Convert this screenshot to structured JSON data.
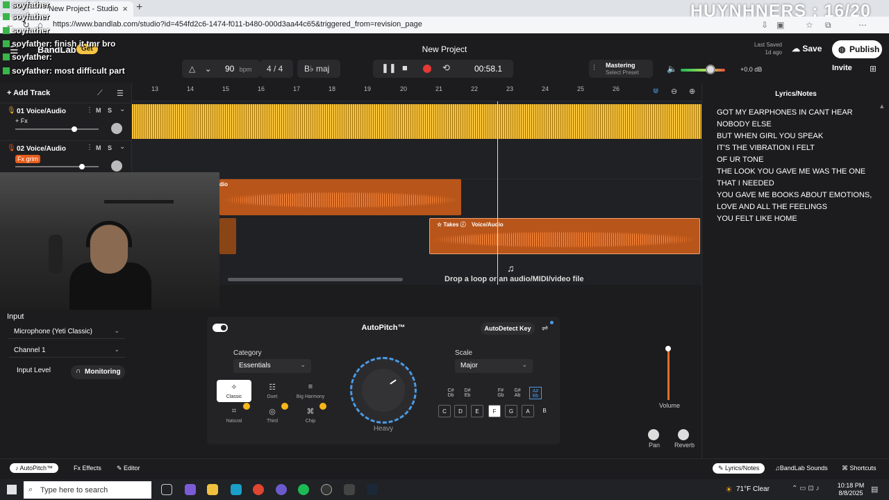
{
  "browser": {
    "tab_title": "New Project - Studio",
    "url": "https://www.bandlab.com/studio?id=454fd2c6-1474-f011-b480-000d3aa44c65&triggered_from=revision_page",
    "overlay_title": "HUYNHNERS : 16/20"
  },
  "chat": [
    {
      "user": "soyfather",
      "message": ""
    },
    {
      "user": "soyfather",
      "message": ""
    },
    {
      "user": "soyfather",
      "message": ""
    },
    {
      "user": "soyfather",
      "message": ": finish it tmr bro"
    },
    {
      "user": "soyfather",
      "message": ":"
    },
    {
      "user": "soyfather",
      "message": ": most difficult part"
    }
  ],
  "header": {
    "brand": "BandLab",
    "get_label": "Get",
    "project_title": "New Project",
    "last_saved_label": "Last Saved",
    "last_saved_value": "1d ago",
    "save_label": "Save",
    "publish_label": "Publish",
    "invite_label": "Invite"
  },
  "transport": {
    "tempo": "90",
    "tempo_unit": "bpm",
    "time_signature": "4 / 4",
    "key": "B♭ maj",
    "timecode": "00:58.1"
  },
  "mastering": {
    "label": "Mastering",
    "sub": "Select Preset"
  },
  "master_volume": {
    "db": "+0.0 dB",
    "level": 0.6
  },
  "tracks": [
    {
      "number": "01",
      "name": "Voice/Audio",
      "fx": "+ Fx",
      "mute": "M",
      "solo": "S",
      "volume": 0.72
    },
    {
      "number": "02",
      "name": "Voice/Audio",
      "fx": "Fx grim",
      "mute": "M",
      "solo": "S",
      "volume": 0.8
    }
  ],
  "add_track_label": "Add Track",
  "ruler": [
    "13",
    "14",
    "15",
    "16",
    "17",
    "18",
    "19",
    "20",
    "21",
    "22",
    "23",
    "24",
    "25",
    "26"
  ],
  "clips": {
    "clip_a_label": "dio",
    "takes_label": "Takes",
    "takes_track": "Voice/Audio"
  },
  "drop_text": "Drop a loop or an audio/MIDI/video file",
  "lyrics": {
    "title": "Lyrics/Notes",
    "lines": [
      "GOT MY EARPHONES IN CANT HEAR",
      "NOBODY ELSE",
      "BUT WHEN GIRL YOU SPEAK",
      "IT'S THE VIBRATION I FELT",
      "OF UR TONE",
      "THE LOOK YOU GAVE ME WAS THE ONE",
      "THAT I NEEDED",
      "YOU GAVE ME BOOKS ABOUT EMOTIONS,",
      "LOVE AND ALL THE FEELINGS",
      "YOU FELT LIKE HOME"
    ]
  },
  "input": {
    "title": "Input",
    "device": "Microphone (Yeti Classic)",
    "channel": "Channel 1",
    "level_label": "Input Level",
    "monitoring_label": "Monitoring"
  },
  "autopitch": {
    "title": "AutoPitch™",
    "autodetect_label": "AutoDetect Key",
    "category_label": "Category",
    "category_value": "Essentials",
    "scale_label": "Scale",
    "scale_value": "Major",
    "presets": [
      "Classic",
      "Duet",
      "Big Harmony",
      "Natural",
      "Third",
      "Chip"
    ],
    "dial_label": "Heavy",
    "accidentals": [
      "C#\nDb",
      "D#\nEb",
      "F#\nGb",
      "G#\nAb",
      "A#\nBb"
    ],
    "keys": [
      "C",
      "D",
      "E",
      "F",
      "G",
      "A",
      "B"
    ]
  },
  "mixer": {
    "volume_label": "Volume",
    "pan_label": "Pan",
    "reverb_label": "Reverb",
    "volume_level": 0.98
  },
  "bottom": {
    "autopitch": "AutoPitch™",
    "effects": "Effects",
    "editor": "Editor",
    "lyrics": "Lyrics/Notes",
    "sounds": "BandLab Sounds",
    "shortcuts": "Shortcuts"
  },
  "taskbar": {
    "search_placeholder": "Type here to search",
    "weather": "71°F  Clear",
    "time": "10:18 PM",
    "date": "8/8/2025"
  },
  "colors": {
    "accent_orange": "#e8702b",
    "accent_yellow": "#d8a51f",
    "accent_blue": "#4a9be6"
  }
}
